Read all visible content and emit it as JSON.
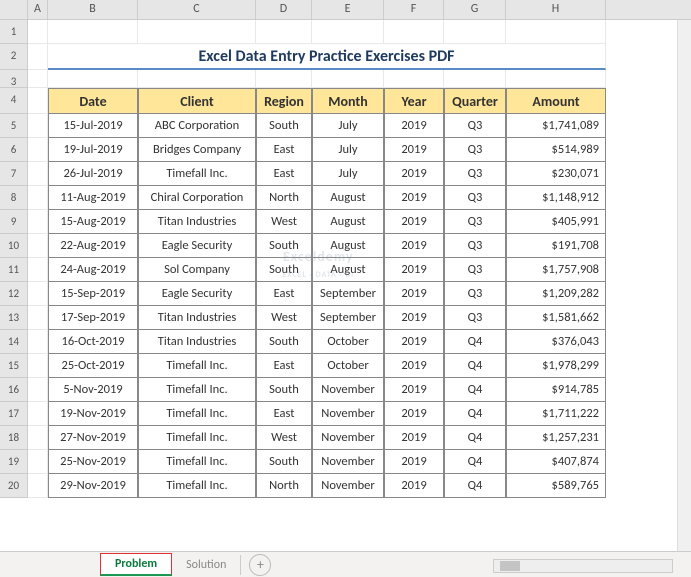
{
  "columns": [
    "A",
    "B",
    "C",
    "D",
    "E",
    "F",
    "G",
    "H"
  ],
  "rowNumbers": [
    1,
    2,
    3,
    4,
    5,
    6,
    7,
    8,
    9,
    10,
    11,
    12,
    13,
    14,
    15,
    16,
    17,
    18,
    19,
    20
  ],
  "title": "Excel Data Entry Practice Exercises PDF",
  "headers": {
    "date": "Date",
    "client": "Client",
    "region": "Region",
    "month": "Month",
    "year": "Year",
    "quarter": "Quarter",
    "amount": "Amount"
  },
  "rows": [
    {
      "date": "15-Jul-2019",
      "client": "ABC Corporation",
      "region": "South",
      "month": "July",
      "year": "2019",
      "quarter": "Q3",
      "amount": "$1,741,089"
    },
    {
      "date": "19-Jul-2019",
      "client": "Bridges Company",
      "region": "East",
      "month": "July",
      "year": "2019",
      "quarter": "Q3",
      "amount": "$514,989"
    },
    {
      "date": "26-Jul-2019",
      "client": "Timefall Inc.",
      "region": "East",
      "month": "July",
      "year": "2019",
      "quarter": "Q3",
      "amount": "$230,071"
    },
    {
      "date": "11-Aug-2019",
      "client": "Chiral Corporation",
      "region": "North",
      "month": "August",
      "year": "2019",
      "quarter": "Q3",
      "amount": "$1,148,912"
    },
    {
      "date": "15-Aug-2019",
      "client": "Titan Industries",
      "region": "West",
      "month": "August",
      "year": "2019",
      "quarter": "Q3",
      "amount": "$405,991"
    },
    {
      "date": "22-Aug-2019",
      "client": "Eagle Security",
      "region": "South",
      "month": "August",
      "year": "2019",
      "quarter": "Q3",
      "amount": "$191,708"
    },
    {
      "date": "24-Aug-2019",
      "client": "Sol Company",
      "region": "South",
      "month": "August",
      "year": "2019",
      "quarter": "Q3",
      "amount": "$1,757,908"
    },
    {
      "date": "15-Sep-2019",
      "client": "Eagle Security",
      "region": "East",
      "month": "September",
      "year": "2019",
      "quarter": "Q3",
      "amount": "$1,209,282"
    },
    {
      "date": "17-Sep-2019",
      "client": "Titan Industries",
      "region": "West",
      "month": "September",
      "year": "2019",
      "quarter": "Q3",
      "amount": "$1,581,662"
    },
    {
      "date": "16-Oct-2019",
      "client": "Titan Industries",
      "region": "South",
      "month": "October",
      "year": "2019",
      "quarter": "Q4",
      "amount": "$376,043"
    },
    {
      "date": "25-Oct-2019",
      "client": "Timefall Inc.",
      "region": "East",
      "month": "October",
      "year": "2019",
      "quarter": "Q4",
      "amount": "$1,978,299"
    },
    {
      "date": "5-Nov-2019",
      "client": "Timefall Inc.",
      "region": "South",
      "month": "November",
      "year": "2019",
      "quarter": "Q4",
      "amount": "$914,785"
    },
    {
      "date": "19-Nov-2019",
      "client": "Timefall Inc.",
      "region": "East",
      "month": "November",
      "year": "2019",
      "quarter": "Q4",
      "amount": "$1,711,222"
    },
    {
      "date": "27-Nov-2019",
      "client": "Timefall Inc.",
      "region": "West",
      "month": "November",
      "year": "2019",
      "quarter": "Q4",
      "amount": "$1,257,231"
    },
    {
      "date": "25-Nov-2019",
      "client": "Timefall Inc.",
      "region": "South",
      "month": "November",
      "year": "2019",
      "quarter": "Q4",
      "amount": "$407,874"
    },
    {
      "date": "29-Nov-2019",
      "client": "Timefall Inc.",
      "region": "North",
      "month": "November",
      "year": "2019",
      "quarter": "Q4",
      "amount": "$589,765"
    }
  ],
  "tabs": {
    "active": "Problem",
    "inactive": "Solution",
    "plus": "+"
  },
  "watermark": {
    "l1": "Exceldemy",
    "l2": "EXCEL · DATA · BI"
  }
}
